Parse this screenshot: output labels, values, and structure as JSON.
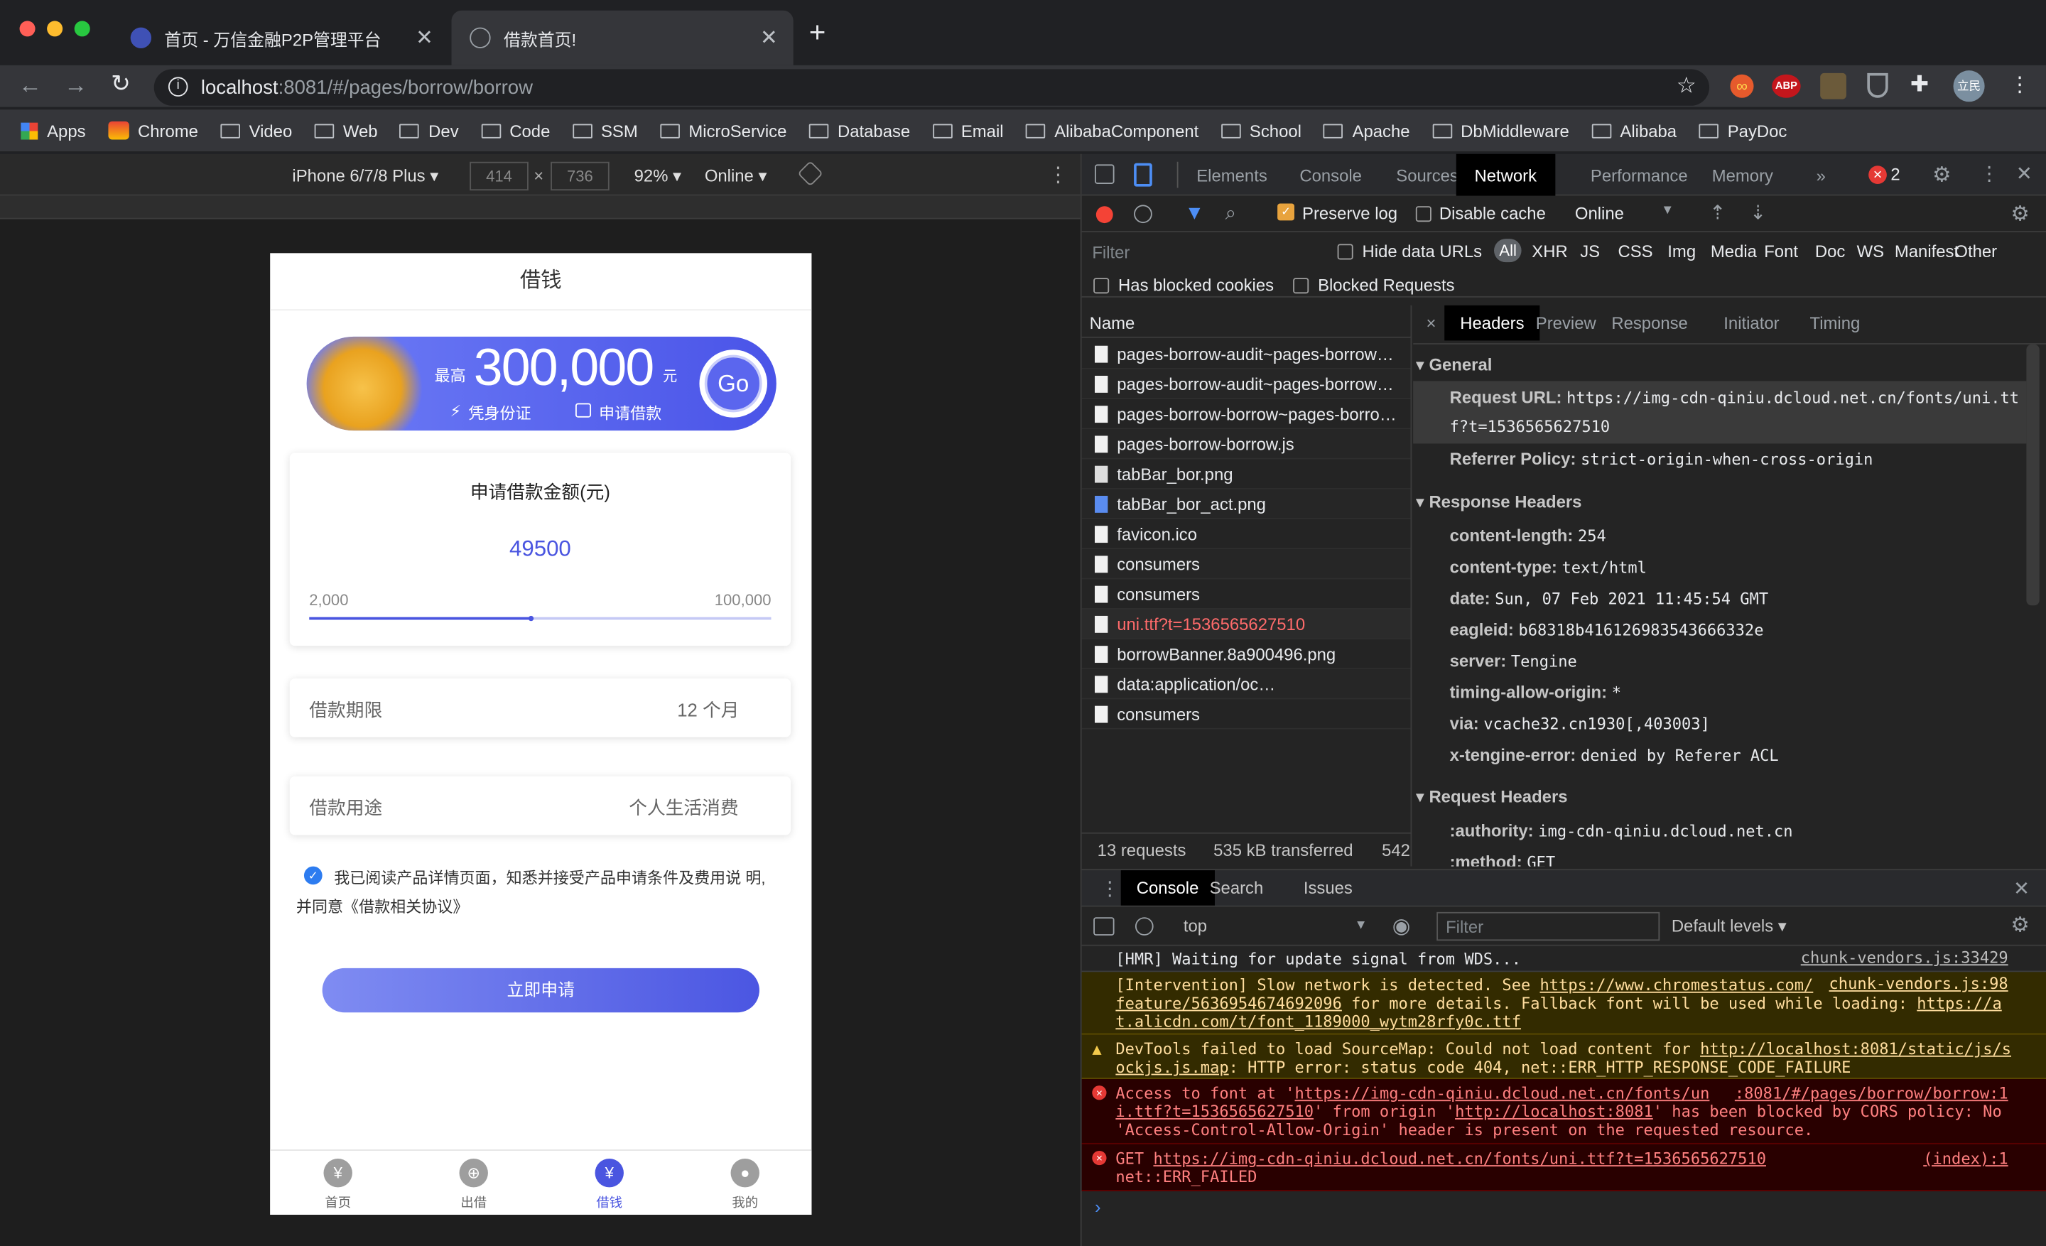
{
  "browser": {
    "tabs": [
      {
        "title": "首页 - 万信金融P2P管理平台",
        "active": false
      },
      {
        "title": "借款首页!",
        "active": true
      }
    ],
    "new_tab": "+",
    "url_host": "localhost",
    "url_rest": ":8081/#/pages/borrow/borrow",
    "bookmarks": [
      "Apps",
      "Chrome",
      "Video",
      "Web",
      "Dev",
      "Code",
      "SSM",
      "MicroService",
      "Database",
      "Email",
      "AlibabaComponent",
      "School",
      "Apache",
      "DbMiddleware",
      "Alibaba",
      "PayDoc"
    ],
    "profile": "立民",
    "abp": "ABP"
  },
  "device_toolbar": {
    "device": "iPhone 6/7/8 Plus ▾",
    "width": "414",
    "height": "736",
    "times": "×",
    "zoom": "92% ▾",
    "network": "Online ▾"
  },
  "app": {
    "title": "借钱",
    "banner": {
      "max_label": "最高",
      "amount": "300,000",
      "unit": "元",
      "feature1": "凭身份证",
      "feature2": "申请借款",
      "go": "Go"
    },
    "amount_card": {
      "title": "申请借款金额(元)",
      "value": "49500",
      "min": "2,000",
      "max": "100,000",
      "slider_fraction": 0.479
    },
    "term": {
      "label": "借款期限",
      "value": "12 个月"
    },
    "purpose": {
      "label": "借款用途",
      "value": "个人生活消费"
    },
    "agreement": {
      "line1": "我已阅读产品详情页面，知悉并接受产品申请条件及费用说 明,",
      "line2": "并同意《借款相关协议》"
    },
    "submit": "立即申请",
    "tabbar": [
      {
        "label": "首页",
        "icon": "¥",
        "active": false
      },
      {
        "label": "出借",
        "icon": "⊕",
        "active": false
      },
      {
        "label": "借钱",
        "icon": "¥",
        "active": true
      },
      {
        "label": "我的",
        "icon": "●",
        "active": false
      }
    ]
  },
  "devtools": {
    "tabs": [
      "Elements",
      "Console",
      "Sources",
      "Network",
      "Performance",
      "Memory",
      "»"
    ],
    "active_tab": "Network",
    "error_count": "2",
    "preserve_log": "Preserve log",
    "disable_cache": "Disable cache",
    "throttle": "Online",
    "filter_placeholder": "Filter",
    "hide_data_urls": "Hide data URLs",
    "type_filters": [
      "All",
      "XHR",
      "JS",
      "CSS",
      "Img",
      "Media",
      "Font",
      "Doc",
      "WS",
      "Manifest",
      "Other"
    ],
    "has_blocked_cookies": "Has blocked cookies",
    "blocked_requests": "Blocked Requests",
    "name_header": "Name",
    "requests": [
      {
        "name": "pages-borrow-audit~pages-borrow…",
        "error": false,
        "type": "doc"
      },
      {
        "name": "pages-borrow-audit~pages-borrow…",
        "error": false,
        "type": "doc"
      },
      {
        "name": "pages-borrow-borrow~pages-borro…",
        "error": false,
        "type": "doc"
      },
      {
        "name": "pages-borrow-borrow.js",
        "error": false,
        "type": "doc"
      },
      {
        "name": "tabBar_bor.png",
        "error": false,
        "type": "img"
      },
      {
        "name": "tabBar_bor_act.png",
        "error": false,
        "type": "img-act"
      },
      {
        "name": "favicon.ico",
        "error": false,
        "type": "doc"
      },
      {
        "name": "consumers",
        "error": false,
        "type": "doc"
      },
      {
        "name": "consumers",
        "error": false,
        "type": "doc"
      },
      {
        "name": "uni.ttf?t=1536565627510",
        "error": true,
        "type": "doc"
      },
      {
        "name": "borrowBanner.8a900496.png",
        "error": false,
        "type": "doc"
      },
      {
        "name": "data:application/oc…",
        "error": false,
        "type": "doc"
      },
      {
        "name": "consumers",
        "error": false,
        "type": "doc"
      }
    ],
    "summary": [
      "13 requests",
      "535 kB transferred",
      "542"
    ],
    "detail_tabs": [
      "Headers",
      "Preview",
      "Response",
      "Initiator",
      "Timing"
    ],
    "detail_close": "×",
    "general_title": "▾ General",
    "request_url_label": "Request URL:",
    "request_url_l1": "https://img-cdn-qiniu.dcloud.net.cn/fonts/uni.tt",
    "request_url_l2": "f?t=1536565627510",
    "referrer_label": "Referrer Policy:",
    "referrer_value": "strict-origin-when-cross-origin",
    "response_headers_title": "▾ Response Headers",
    "response_headers": [
      {
        "k": "content-length:",
        "v": "254"
      },
      {
        "k": "content-type:",
        "v": "text/html"
      },
      {
        "k": "date:",
        "v": "Sun, 07 Feb 2021 11:45:54 GMT"
      },
      {
        "k": "eagleid:",
        "v": "b68318b416126983543666332e"
      },
      {
        "k": "server:",
        "v": "Tengine"
      },
      {
        "k": "timing-allow-origin:",
        "v": "*"
      },
      {
        "k": "via:",
        "v": "vcache32.cn1930[,403003]"
      },
      {
        "k": "x-tengine-error:",
        "v": "denied by Referer ACL"
      }
    ],
    "request_headers_title": "▾ Request Headers",
    "request_headers": [
      {
        "k": ":authority:",
        "v": "img-cdn-qiniu.dcloud.net.cn"
      },
      {
        "k": ":method:",
        "v": "GET"
      }
    ],
    "drawer_tabs": [
      "Console",
      "Search",
      "Issues"
    ],
    "context": "top",
    "console_filter": "Filter",
    "levels": "Default levels ▾",
    "messages": [
      {
        "level": "info",
        "text": "[HMR] Waiting for update signal from WDS...",
        "source": "chunk-vendors.js:33429"
      },
      {
        "level": "warn-plain",
        "l1a": "[Intervention] Slow network is detected. See ",
        "l1b": "https://www.chromestatus.com/",
        "l2a": "feature/5636954674692096",
        "l2b": " for more details. Fallback font will be used while loading: ",
        "l2c": "https://a",
        "l3": "t.alicdn.com/t/font_1189000_wytm28rfy0c.ttf",
        "source": "chunk-vendors.js:98"
      },
      {
        "level": "warn",
        "l1a": "DevTools failed to load SourceMap: Could not load content for ",
        "l1b": "http://localhost:8081/static/js/s",
        "l2a": "ockjs.js.map",
        "l2b": ": HTTP error: status code 404, net::ERR_HTTP_RESPONSE_CODE_FAILURE"
      },
      {
        "level": "error",
        "l1a": "Access to font at '",
        "l1b": "https://img-cdn-qiniu.dcloud.net.cn/fonts/un",
        "l2a": "i.ttf?t=1536565627510",
        "l2b": "' from origin '",
        "l2c": "http://localhost:8081",
        "l2d": "' has been blocked by CORS policy: No",
        "l3": "'Access-Control-Allow-Origin' header is present on the requested resource.",
        "source": ":8081/#/pages/borrow/borrow:1"
      },
      {
        "level": "error",
        "l1a": "GET ",
        "l1b": "https://img-cdn-qiniu.dcloud.net.cn/fonts/uni.ttf?t=1536565627510",
        "l2": "net::ERR_FAILED",
        "source": "(index):1"
      }
    ],
    "prompt": "›"
  },
  "colors": {
    "accent": "#5b6cf0",
    "devtools_bg": "#242424",
    "error_bg": "#290000",
    "warn_bg": "#332b00",
    "error_text": "#ff8080",
    "warn_text": "#ffdd9e"
  }
}
